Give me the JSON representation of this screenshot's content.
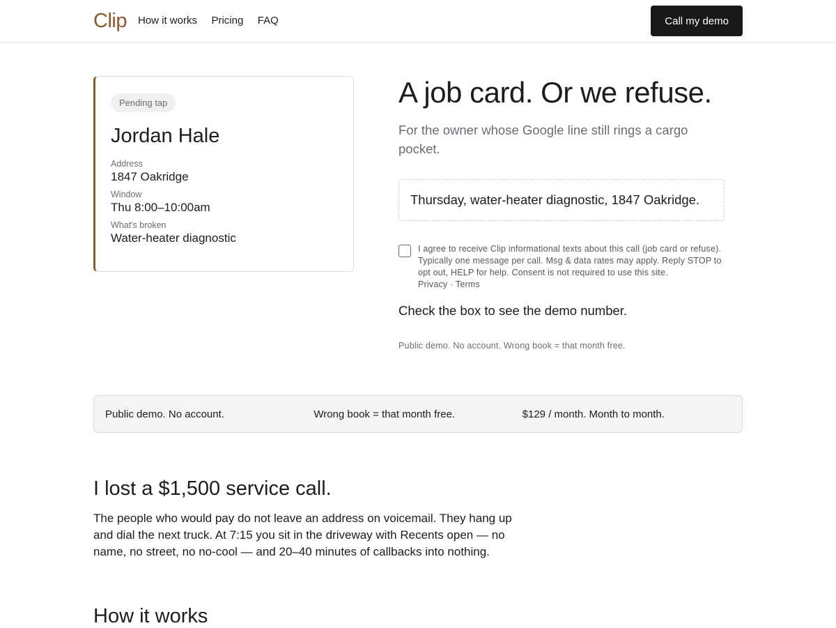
{
  "header": {
    "logo": "Clip",
    "nav": [
      "How it works",
      "Pricing",
      "FAQ"
    ],
    "cta": "Call my demo"
  },
  "card": {
    "status": "Pending tap",
    "name": "Jordan Hale",
    "fields": [
      {
        "label": "Address",
        "value": "1847 Oakridge"
      },
      {
        "label": "Window",
        "value": "Thu 8:00–10:00am"
      },
      {
        "label": "What's broken",
        "value": "Water-heater diagnostic"
      }
    ]
  },
  "hero": {
    "headline": "A job card. Or we refuse.",
    "sub": "For the owner whose Google line still rings a cargo pocket.",
    "quote": "Thursday, water-heater diagnostic, 1847 Oakridge.",
    "consent": "I agree to receive Clip informational texts about this call (job card or refuse). Typically one message per call. Msg & data rates may apply. Reply STOP to opt out, HELP for help. Consent is not required to use this site.",
    "privacy": "Privacy",
    "terms": "Terms",
    "check_msg": "Check the box to see the demo number.",
    "fine": "Public demo. No account. Wrong book = that month free."
  },
  "strip": [
    "Public demo. No account.",
    "Wrong book = that month free.",
    "$129 / month. Month to month."
  ],
  "lost": {
    "title": "I lost a $1,500 service call.",
    "body": "The people who would pay do not leave an address on voicemail. They hang up and dial the next truck. At 7:15 you sit in the driveway with Recents open — no name, no street, no no-cool — and 20–40 minutes of callbacks into nothing."
  },
  "how": {
    "title": "How it works"
  }
}
